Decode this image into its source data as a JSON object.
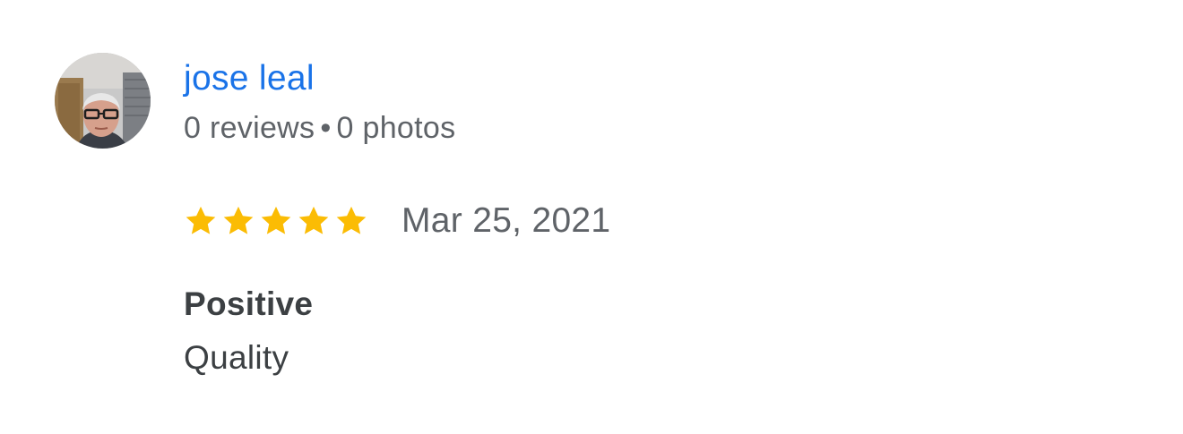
{
  "review": {
    "author": {
      "name": "jose leal",
      "reviews_text": "0 reviews",
      "separator": "•",
      "photos_text": "0 photos",
      "avatar_icon": "profile-photo"
    },
    "rating": {
      "stars": 5,
      "max_stars": 5,
      "star_color": "#fbbc04",
      "date": "Mar 25, 2021"
    },
    "attributes": [
      {
        "label": "Positive",
        "value": "Quality"
      }
    ]
  },
  "colors": {
    "link": "#1a73e8",
    "secondary_text": "#5f6368",
    "primary_text": "#3c4043"
  }
}
